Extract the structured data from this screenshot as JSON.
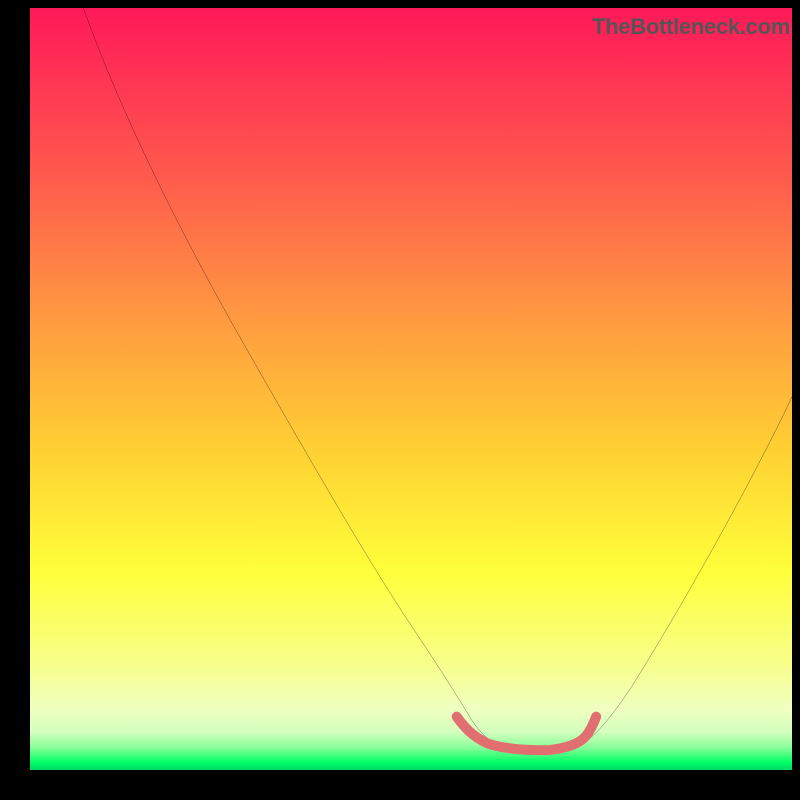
{
  "attribution": "TheBottleneck.com",
  "chart_data": {
    "type": "line",
    "title": "",
    "xlabel": "",
    "ylabel": "",
    "xlim": [
      0,
      100
    ],
    "ylim": [
      0,
      100
    ],
    "grid": false,
    "legend": false,
    "background_gradient": {
      "top": "#ff1959",
      "upper_mid": "#ff7a4a",
      "mid": "#ffd033",
      "lower_mid": "#ffff3a",
      "lower": "#f2ffa0",
      "bottom_green": "#00ff66"
    },
    "series": [
      {
        "name": "bottleneck-curve",
        "color": "#000000",
        "x": [
          7,
          10,
          15,
          20,
          25,
          30,
          35,
          40,
          45,
          50,
          55,
          58,
          60,
          62,
          64,
          66,
          68,
          70,
          72,
          76,
          80,
          84,
          88,
          92,
          96,
          100
        ],
        "values": [
          100,
          93,
          83,
          73,
          63,
          53,
          44,
          35,
          27,
          19,
          11,
          7,
          5,
          3,
          2.5,
          2.5,
          2.5,
          2.5,
          3,
          6,
          11,
          18,
          26,
          35,
          44,
          53
        ]
      },
      {
        "name": "optimum-stub",
        "color": "#e26f6f",
        "x": [
          56,
          57,
          58,
          60,
          62,
          64,
          66,
          68,
          70,
          72,
          73,
          74
        ],
        "values": [
          7,
          5.5,
          4.5,
          3.5,
          3,
          2.7,
          2.7,
          2.7,
          3,
          3.5,
          4.5,
          6
        ]
      }
    ]
  }
}
